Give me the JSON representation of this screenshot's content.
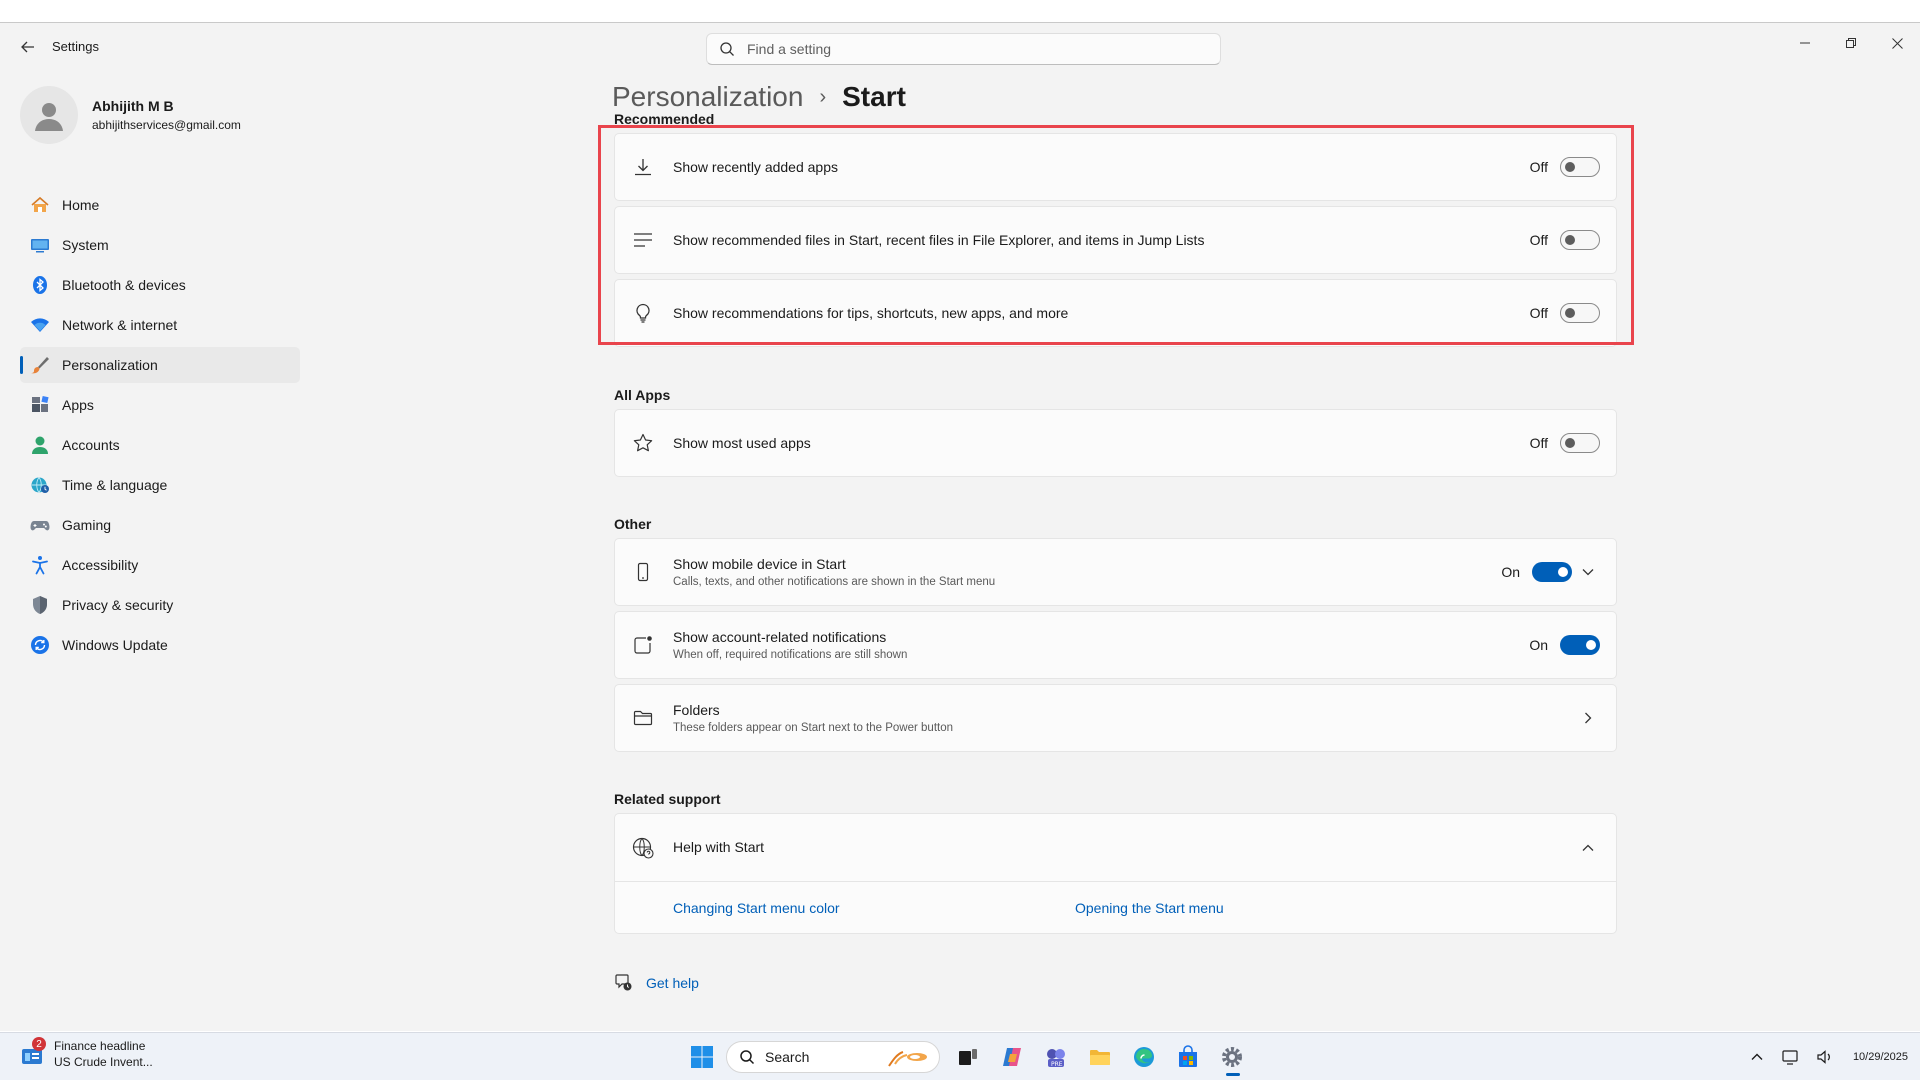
{
  "window": {
    "app_title": "Settings",
    "search_placeholder": "Find a setting"
  },
  "profile": {
    "name": "Abhijith M B",
    "email": "abhijithservices@gmail.com"
  },
  "nav": [
    {
      "label": "Home",
      "icon": "home-icon"
    },
    {
      "label": "System",
      "icon": "system-icon"
    },
    {
      "label": "Bluetooth & devices",
      "icon": "bluetooth-icon"
    },
    {
      "label": "Network & internet",
      "icon": "wifi-icon"
    },
    {
      "label": "Personalization",
      "icon": "brush-icon",
      "active": true
    },
    {
      "label": "Apps",
      "icon": "apps-icon"
    },
    {
      "label": "Accounts",
      "icon": "accounts-icon"
    },
    {
      "label": "Time & language",
      "icon": "globe-clock-icon"
    },
    {
      "label": "Gaming",
      "icon": "gamepad-icon"
    },
    {
      "label": "Accessibility",
      "icon": "accessibility-icon"
    },
    {
      "label": "Privacy & security",
      "icon": "shield-icon"
    },
    {
      "label": "Windows Update",
      "icon": "update-icon"
    }
  ],
  "breadcrumb": {
    "parent": "Personalization",
    "separator": "›",
    "current": "Start"
  },
  "sections": {
    "recommended": "Recommended",
    "all_apps": "All Apps",
    "other": "Other",
    "related_support": "Related support"
  },
  "settings": {
    "recently_added": {
      "title": "Show recently added apps",
      "state": "Off"
    },
    "recommended_files": {
      "title": "Show recommended files in Start, recent files in File Explorer, and items in Jump Lists",
      "state": "Off"
    },
    "recommendations": {
      "title": "Show recommendations for tips, shortcuts, new apps, and more",
      "state": "Off"
    },
    "most_used": {
      "title": "Show most used apps",
      "state": "Off"
    },
    "mobile_device": {
      "title": "Show mobile device in Start",
      "subtitle": "Calls, texts, and other notifications are shown in the Start menu",
      "state": "On"
    },
    "account_notifications": {
      "title": "Show account-related notifications",
      "subtitle": "When off, required notifications are still shown",
      "state": "On"
    },
    "folders": {
      "title": "Folders",
      "subtitle": "These folders appear on Start next to the Power button"
    }
  },
  "support": {
    "help_title": "Help with Start",
    "links": [
      "Changing Start menu color",
      "Opening the Start menu"
    ],
    "get_help": "Get help"
  },
  "taskbar": {
    "widget_badge": "2",
    "widget_line1": "Finance headline",
    "widget_line2": "US Crude Invent...",
    "search_label": "Search",
    "date": "10/29/2025"
  },
  "colors": {
    "accent": "#005fb8",
    "highlight_border": "#e9444c"
  }
}
